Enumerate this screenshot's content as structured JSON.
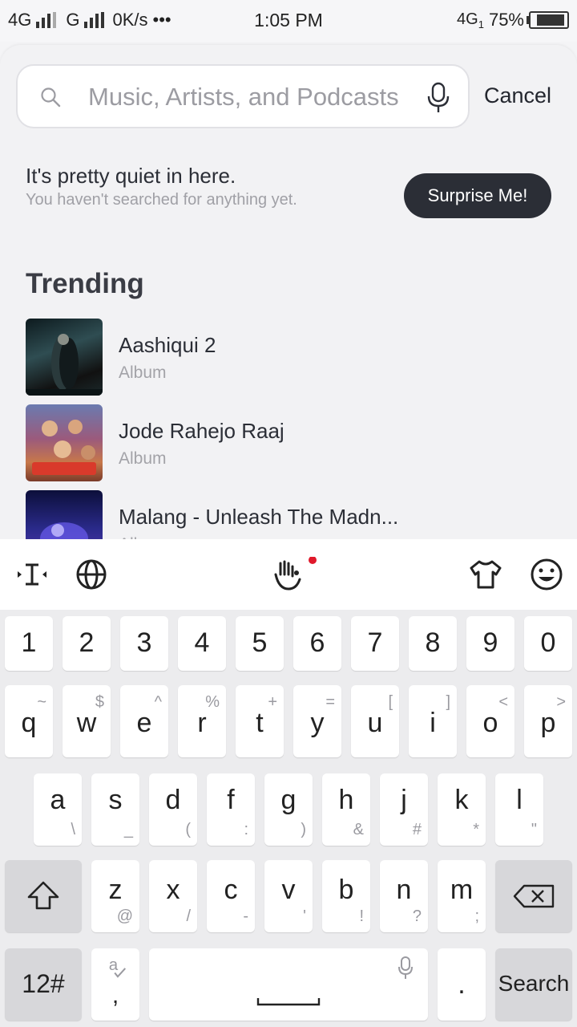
{
  "status_bar": {
    "left_text_1": "4G",
    "left_text_2": "G",
    "speed": "0K/s",
    "dots": "•••",
    "time": "1:05 PM",
    "network": "4G",
    "network_sub": "1",
    "battery": "75%"
  },
  "search": {
    "placeholder": "Music, Artists, and Podcasts",
    "value": "",
    "cancel_label": "Cancel"
  },
  "empty_state": {
    "title": "It's pretty quiet in here.",
    "subtitle": "You haven't searched for anything yet.",
    "surprise_label": "Surprise Me!"
  },
  "trending": {
    "heading": "Trending",
    "items": [
      {
        "title": "Aashiqui 2",
        "type": "Album"
      },
      {
        "title": "Jode Rahejo Raaj",
        "type": "Album"
      },
      {
        "title": "Malang - Unleash The Madn...",
        "type": "Album"
      }
    ]
  },
  "keyboard": {
    "numbers": [
      "1",
      "2",
      "3",
      "4",
      "5",
      "6",
      "7",
      "8",
      "9",
      "0"
    ],
    "row1": [
      {
        "k": "q",
        "a": "~"
      },
      {
        "k": "w",
        "a": "$"
      },
      {
        "k": "e",
        "a": "^"
      },
      {
        "k": "r",
        "a": "%"
      },
      {
        "k": "t",
        "a": "+"
      },
      {
        "k": "y",
        "a": "="
      },
      {
        "k": "u",
        "a": "["
      },
      {
        "k": "i",
        "a": "]"
      },
      {
        "k": "o",
        "a": "<"
      },
      {
        "k": "p",
        "a": ">"
      }
    ],
    "row2": [
      {
        "k": "a",
        "a": "\\"
      },
      {
        "k": "s",
        "a": "_"
      },
      {
        "k": "d",
        "a": "("
      },
      {
        "k": "f",
        "a": ":"
      },
      {
        "k": "g",
        "a": ")"
      },
      {
        "k": "h",
        "a": "&"
      },
      {
        "k": "j",
        "a": "#"
      },
      {
        "k": "k",
        "a": "*"
      },
      {
        "k": "l",
        "a": "\""
      }
    ],
    "row3": [
      {
        "k": "z",
        "a": "@"
      },
      {
        "k": "x",
        "a": "/"
      },
      {
        "k": "c",
        "a": "-"
      },
      {
        "k": "v",
        "a": "'"
      },
      {
        "k": "b",
        "a": "!"
      },
      {
        "k": "n",
        "a": "?"
      },
      {
        "k": "m",
        "a": ";"
      }
    ],
    "symbols_label": "12#",
    "comma": ",",
    "period": ".",
    "search_label": "Search"
  }
}
